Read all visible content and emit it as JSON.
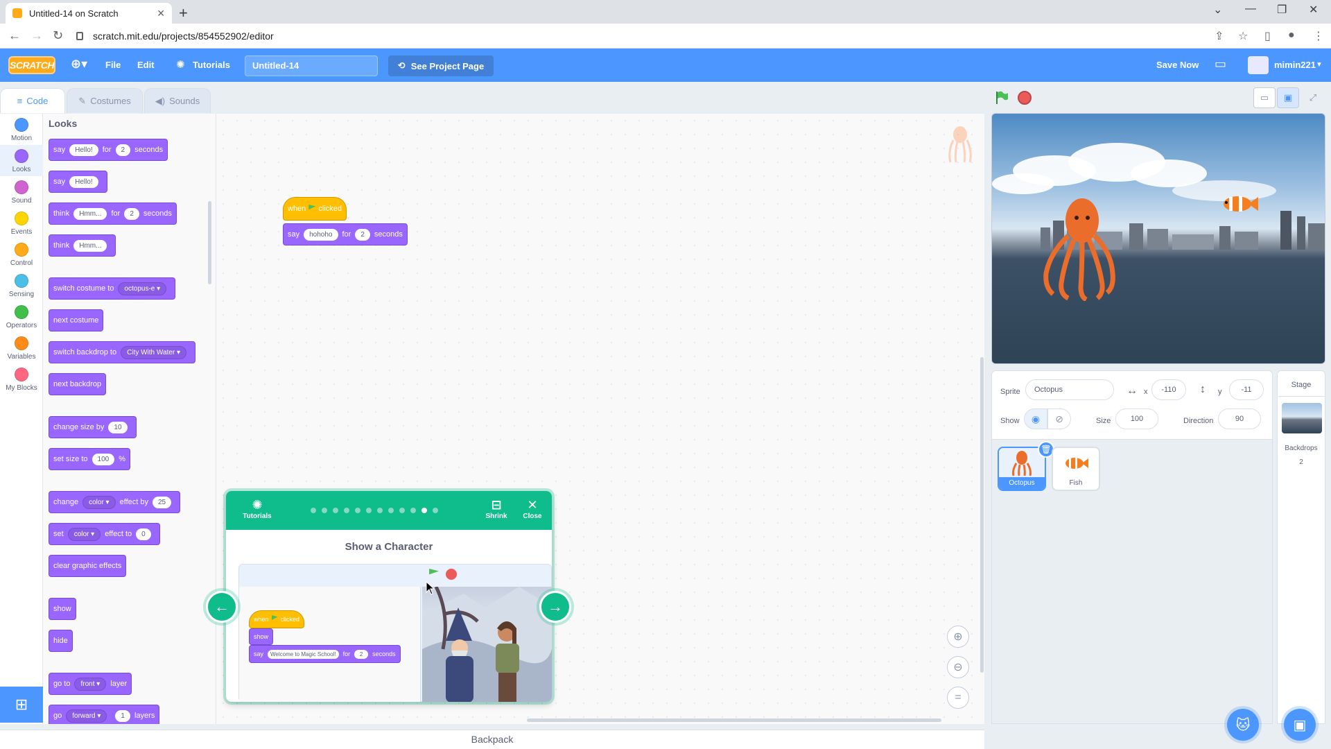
{
  "browser": {
    "tab_title": "Untitled-14 on Scratch",
    "url": "scratch.mit.edu/projects/854552902/editor"
  },
  "menubar": {
    "logo": "SCRATCH",
    "file": "File",
    "edit": "Edit",
    "tutorials": "Tutorials",
    "project_title": "Untitled-14",
    "see_project": "See Project Page",
    "save_now": "Save Now",
    "username": "mimin221"
  },
  "editor_tabs": {
    "code": "Code",
    "costumes": "Costumes",
    "sounds": "Sounds"
  },
  "categories": [
    {
      "label": "Motion",
      "color": "#4c97ff"
    },
    {
      "label": "Looks",
      "color": "#9966ff"
    },
    {
      "label": "Sound",
      "color": "#cf63cf"
    },
    {
      "label": "Events",
      "color": "#ffd500"
    },
    {
      "label": "Control",
      "color": "#ffab19"
    },
    {
      "label": "Sensing",
      "color": "#4cbfe6"
    },
    {
      "label": "Operators",
      "color": "#40bf4a"
    },
    {
      "label": "Variables",
      "color": "#ff8c1a"
    },
    {
      "label": "My Blocks",
      "color": "#ff6680"
    }
  ],
  "palette": {
    "title": "Looks",
    "say_for": {
      "say": "say",
      "msg": "Hello!",
      "for": "for",
      "secs": "2",
      "seconds": "seconds"
    },
    "say": {
      "say": "say",
      "msg": "Hello!"
    },
    "think_for": {
      "think": "think",
      "msg": "Hmm...",
      "for": "for",
      "secs": "2",
      "seconds": "seconds"
    },
    "think": {
      "think": "think",
      "msg": "Hmm..."
    },
    "switch_costume": {
      "label": "switch costume to",
      "value": "octopus-e"
    },
    "next_costume": "next costume",
    "switch_backdrop": {
      "label": "switch backdrop to",
      "value": "City With Water"
    },
    "next_backdrop": "next backdrop",
    "change_size": {
      "label": "change size by",
      "value": "10"
    },
    "set_size": {
      "label": "set size to",
      "value": "100",
      "unit": "%"
    },
    "change_effect": {
      "change": "change",
      "effect": "color",
      "by": "effect by",
      "value": "25"
    },
    "set_effect": {
      "set": "set",
      "effect": "color",
      "to": "effect to",
      "value": "0"
    },
    "clear_effects": "clear graphic effects",
    "show": "show",
    "hide": "hide",
    "go_to": {
      "go_to": "go to",
      "value": "front",
      "layer": "layer"
    },
    "go_layers": {
      "go": "go",
      "value": "forward",
      "num": "1",
      "layers": "layers"
    }
  },
  "script": {
    "when": "when",
    "clicked": "clicked",
    "say": "say",
    "msg": "hohoho",
    "for": "for",
    "secs": "2",
    "seconds": "seconds"
  },
  "tutorial": {
    "tutorials": "Tutorials",
    "shrink": "Shrink",
    "close": "Close",
    "title": "Show a Character",
    "step_total": 12,
    "step_current": 11,
    "script": {
      "when": "when",
      "clicked": "clicked",
      "show": "show",
      "say": "say",
      "msg": "Welcome to Magic School!",
      "for": "for",
      "secs": "2",
      "seconds": "seconds"
    }
  },
  "backpack": "Backpack",
  "sprite_info": {
    "sprite_label": "Sprite",
    "sprite_name": "Octopus",
    "x_label": "x",
    "x": "-110",
    "y_label": "y",
    "y": "-11",
    "show_label": "Show",
    "size_label": "Size",
    "size": "100",
    "direction_label": "Direction",
    "direction": "90"
  },
  "sprites": [
    {
      "name": "Octopus",
      "selected": true
    },
    {
      "name": "Fish",
      "selected": false
    }
  ],
  "stage_panel": {
    "title": "Stage",
    "backdrops_label": "Backdrops",
    "backdrops_count": "2"
  }
}
